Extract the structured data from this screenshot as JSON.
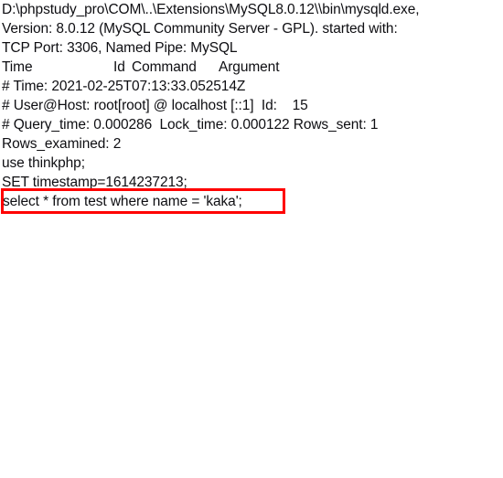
{
  "document": {
    "kind": "mysql-slow-query-log",
    "background_color": "#ffffff",
    "text_color": "#0e0e12"
  },
  "log": {
    "lines": [
      "D:\\phpstudy_pro\\COM\\..\\Extensions\\MySQL8.0.12\\\\bin\\mysqld.exe,",
      "Version: 8.0.12 (MySQL Community Server - GPL). started with:",
      "TCP Port: 3306, Named Pipe: MySQL"
    ],
    "header_row": {
      "time": "Time",
      "id": "Id",
      "command": "Command",
      "argument": "Argument"
    },
    "entry_lines": [
      "# Time: 2021-02-25T07:13:33.052514Z",
      "# User@Host: root[root] @ localhost [::1]  Id:    15",
      "# Query_time: 0.000286  Lock_time: 0.000122 Rows_sent: 1",
      "Rows_examined: 2",
      "use thinkphp;",
      "SET timestamp=1614237213;"
    ],
    "query_line": "select * from test where name = 'kaka';"
  },
  "annotation": {
    "type": "rectangle-highlight",
    "color": "#ff0000",
    "border_width_px": 3,
    "targets": "query_line"
  }
}
